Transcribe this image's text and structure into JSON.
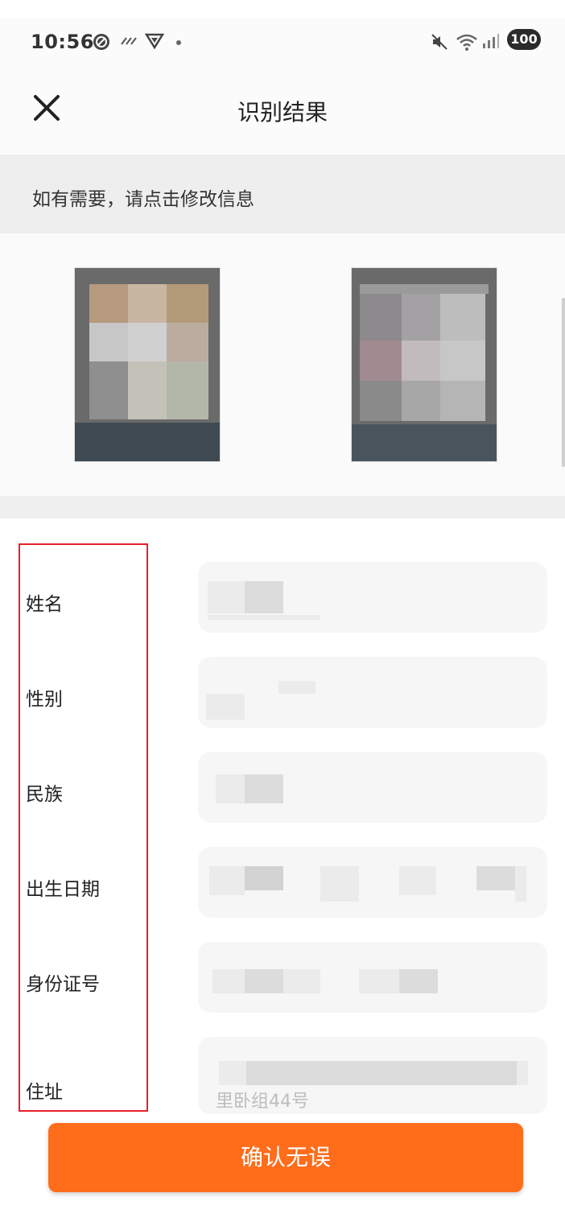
{
  "status_bar": {
    "time": "10:56",
    "battery": "100"
  },
  "header": {
    "title": "识别结果",
    "close_icon": "close-icon"
  },
  "hint": "如有需要，请点击修改信息",
  "form": {
    "fields": [
      {
        "label": "姓名"
      },
      {
        "label": "性别"
      },
      {
        "label": "民族"
      },
      {
        "label": "出生日期"
      },
      {
        "label": "身份证号"
      },
      {
        "label": "住址",
        "value_tail": "里卧组44号"
      }
    ]
  },
  "actions": {
    "confirm_label": "确认无误"
  },
  "colors": {
    "accent": "#ff6d1b",
    "highlight_frame": "#e8202a"
  }
}
